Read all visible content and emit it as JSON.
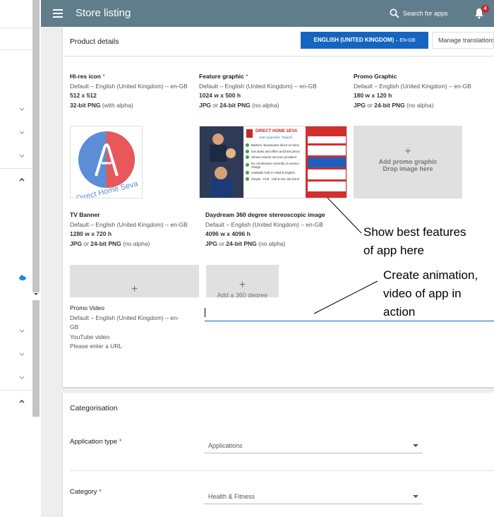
{
  "topbar": {
    "title": "Store listing",
    "search_label": "Search for apps",
    "notification_count": "4"
  },
  "product_details": {
    "title": "Product details",
    "language_button": "ENGLISH (UNITED KINGDOM)",
    "language_code": "– EN-GB",
    "manage_button": "Manage translations"
  },
  "fields": {
    "hires": {
      "title": "Hi-res icon",
      "required": "*",
      "lang": "Default – English (United Kingdom) – en-GB",
      "size": "512 x 512",
      "format_bold": "32-bit PNG",
      "format_rest": " (with alpha)"
    },
    "feature": {
      "title": "Feature graphic",
      "required": "*",
      "lang": "Default – English (United Kingdom) – en-GB",
      "size": "1024 w x 500 h",
      "format_bold1": "JPG",
      "format_mid": " or ",
      "format_bold2": "24-bit PNG",
      "format_rest": " (no alpha)"
    },
    "promo": {
      "title": "Promo Graphic",
      "lang": "Default – English (United Kingdom) – en-GB",
      "size": "180 w x 120 h",
      "format_bold1": "JPG",
      "format_mid": " or ",
      "format_bold2": "24-bit PNG",
      "format_rest": " (no alpha)",
      "placeholder_line1": "Add promo graphic",
      "placeholder_line2": "Drop image here"
    },
    "tv": {
      "title": "TV Banner",
      "lang": "Default – English (United Kingdom) – en-GB",
      "size": "1280 w x 720 h",
      "format_bold1": "JPG",
      "format_mid": " or ",
      "format_bold2": "24-bit PNG",
      "format_rest": " (no alpha)"
    },
    "daydream": {
      "title": "Daydream 360 degree stereoscopic image",
      "lang": "Default – English (United Kingdom) – en-GB",
      "size": "4096 w x 4096 h",
      "format_bold1": "JPG",
      "format_mid": " or ",
      "format_bold2": "24-bit PNG",
      "format_rest": " (no alpha)",
      "placeholder_text": "Add a 360 degree"
    },
    "video": {
      "title": "Promo Video",
      "lang_line1": "Default – English (United Kingdom) – en-",
      "lang_line2": "GB",
      "type": "YouTube video",
      "hint": "Please enter a URL"
    }
  },
  "feature_graphic": {
    "brand": "DIRECT HOME SEVA",
    "tagline": "Just Launched : Ranchi",
    "bullets": [
      "Barbers, Beauticians direct to home",
      "Get deals and offers and best prices",
      "Shows nearest services providers",
      "No commission currently on service charge",
      "Available both in Hindi & English",
      "Simple - Find , Call & Get Job Done"
    ]
  },
  "logo_text": "Direct Home Seva",
  "annotations": {
    "callout1_line1": "Show best features",
    "callout1_line2": "of app here",
    "callout2_line1": "Create animation,",
    "callout2_line2": "video of app in",
    "callout2_line3": "action"
  },
  "categorisation": {
    "title": "Categorisation",
    "app_type_label": "Application type",
    "app_type_value": "Applications",
    "category_label": "Category",
    "category_value": "Health & Fitness",
    "required": "*"
  },
  "colors": {
    "topbar": "#607d8b",
    "accent": "#1565c0",
    "badge": "#c62828"
  }
}
